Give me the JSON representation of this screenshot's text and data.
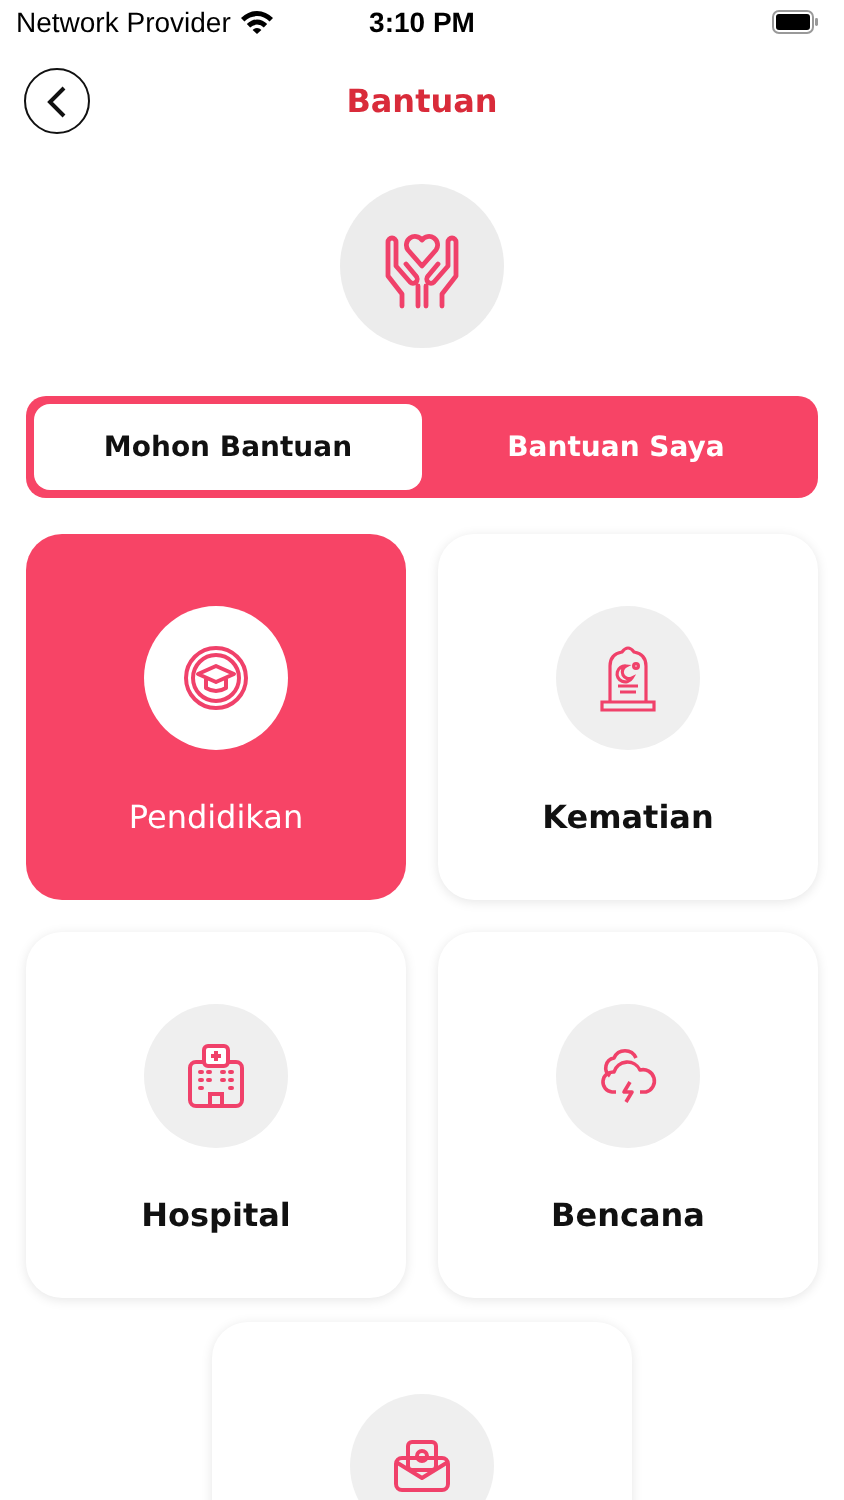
{
  "status_bar": {
    "carrier": "Network Provider",
    "time": "3:10 PM"
  },
  "header": {
    "title": "Bantuan"
  },
  "tabs": [
    {
      "label": "Mohon Bantuan",
      "selected": true
    },
    {
      "label": "Bantuan Saya",
      "selected": false
    }
  ],
  "categories": [
    {
      "label": "Pendidikan",
      "selected": true
    },
    {
      "label": "Kematian",
      "selected": false
    },
    {
      "label": "Hospital",
      "selected": false
    },
    {
      "label": "Bencana",
      "selected": false
    },
    {
      "selected": false
    }
  ]
}
